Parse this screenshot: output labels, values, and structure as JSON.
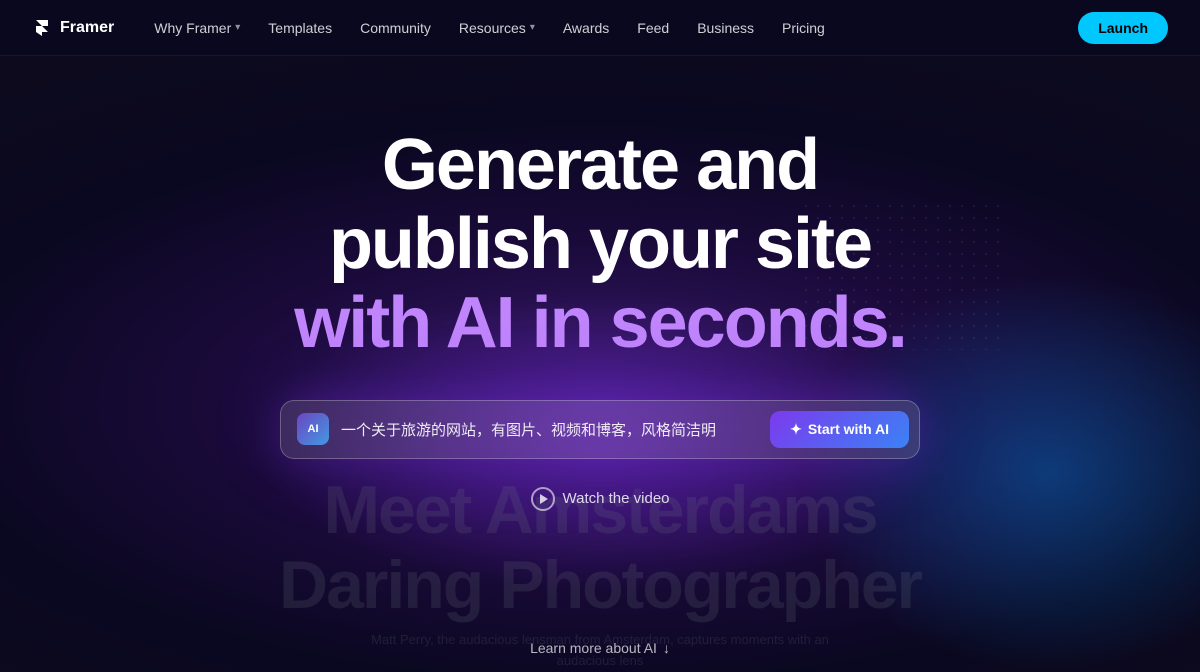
{
  "nav": {
    "logo_text": "Framer",
    "links": [
      {
        "label": "Why Framer",
        "has_arrow": true,
        "name": "why-framer"
      },
      {
        "label": "Templates",
        "has_arrow": false,
        "name": "templates"
      },
      {
        "label": "Community",
        "has_arrow": false,
        "name": "community"
      },
      {
        "label": "Resources",
        "has_arrow": true,
        "name": "resources"
      },
      {
        "label": "Awards",
        "has_arrow": false,
        "name": "awards"
      },
      {
        "label": "Feed",
        "has_arrow": false,
        "name": "feed"
      },
      {
        "label": "Business",
        "has_arrow": false,
        "name": "business"
      },
      {
        "label": "Pricing",
        "has_arrow": false,
        "name": "pricing"
      }
    ],
    "launch_button": "Launch"
  },
  "hero": {
    "title_line1": "Generate and",
    "title_line2": "publish your site",
    "title_line3": "with AI in seconds."
  },
  "search": {
    "ai_badge_text": "AI",
    "placeholder": "一个关于旅游的网站，有图片、视频和博客，风格简洁明",
    "current_value": "一个关于旅游的网站，有图片、视频和博客，风格简洁明",
    "button_label": "Start with AI",
    "button_icon": "✦"
  },
  "watch_video": {
    "label": "Watch the video"
  },
  "bg_section": {
    "title_line1": "Meet Amsterdams",
    "title_line2": "Daring Photographer",
    "body": "Matt Perry, the audacious lensman from Amsterdam, captures moments with an audacious lens"
  },
  "learn_more": {
    "label": "Learn more about AI",
    "icon": "↓"
  },
  "colors": {
    "accent_cyan": "#00c8ff",
    "accent_purple": "#7c3aed",
    "accent_blue": "#3b82f6",
    "title_pink": "#c084fc"
  }
}
